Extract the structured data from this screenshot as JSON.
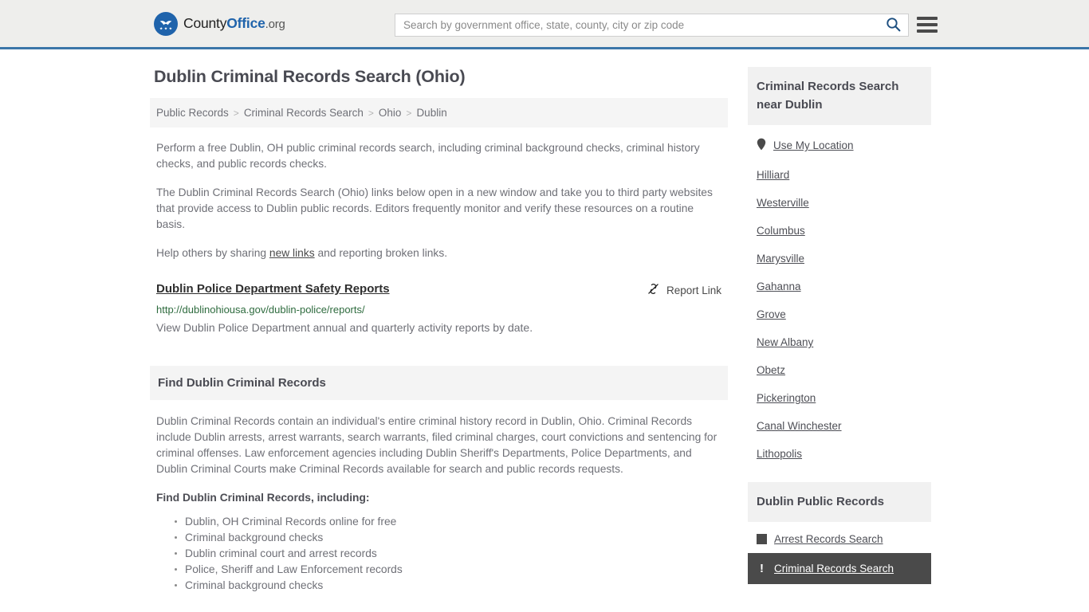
{
  "header": {
    "brand": {
      "part1": "County",
      "part2": "Office",
      "part3": ".org"
    },
    "search": {
      "placeholder": "Search by government office, state, county, city or zip code",
      "value": ""
    }
  },
  "page_title": "Dublin Criminal Records Search (Ohio)",
  "breadcrumb": [
    "Public Records",
    "Criminal Records Search",
    "Ohio",
    "Dublin"
  ],
  "breadcrumb_separator": ">",
  "intro": {
    "p1": "Perform a free Dublin, OH public criminal records search, including criminal background checks, criminal history checks, and public records checks.",
    "p2": "The Dublin Criminal Records Search (Ohio) links below open in a new window and take you to third party websites that provide access to Dublin public records. Editors frequently monitor and verify these resources on a routine basis.",
    "p3_before": "Help others by sharing ",
    "p3_link": "new links",
    "p3_after": " and reporting broken links."
  },
  "result": {
    "title": "Dublin Police Department Safety Reports",
    "report_label": "Report Link",
    "url": "http://dublinohiousa.gov/dublin-police/reports/",
    "description": "View Dublin Police Department annual and quarterly activity reports by date."
  },
  "find_section": {
    "heading": "Find Dublin Criminal Records",
    "paragraph": "Dublin Criminal Records contain an individual's entire criminal history record in Dublin, Ohio. Criminal Records include Dublin arrests, arrest warrants, search warrants, filed criminal charges, court convictions and sentencing for criminal offenses. Law enforcement agencies including Dublin Sheriff's Departments, Police Departments, and Dublin Criminal Courts make Criminal Records available for search and public records requests.",
    "list_heading": "Find Dublin Criminal Records, including:",
    "items": [
      "Dublin, OH Criminal Records online for free",
      "Criminal background checks",
      "Dublin criminal court and arrest records",
      "Police, Sheriff and Law Enforcement records",
      "Criminal background checks"
    ]
  },
  "sidebar": {
    "nearby": {
      "heading": "Criminal Records Search near Dublin",
      "use_location": "Use My Location",
      "cities": [
        "Hilliard",
        "Westerville",
        "Columbus",
        "Marysville",
        "Gahanna",
        "Grove",
        "New Albany",
        "Obetz",
        "Pickerington",
        "Canal Winchester",
        "Lithopolis"
      ]
    },
    "public_records": {
      "heading": "Dublin Public Records",
      "items": [
        {
          "label": "Arrest Records Search",
          "icon": "square-icon",
          "active": false
        },
        {
          "label": "Criminal Records Search",
          "icon": "exclamation-icon",
          "active": true
        }
      ]
    }
  },
  "colors": {
    "brand_blue": "#1f63ab",
    "header_border": "#3b76a8",
    "url_green": "#2e6b3e",
    "highlight_bg": "#4a4a4a"
  }
}
